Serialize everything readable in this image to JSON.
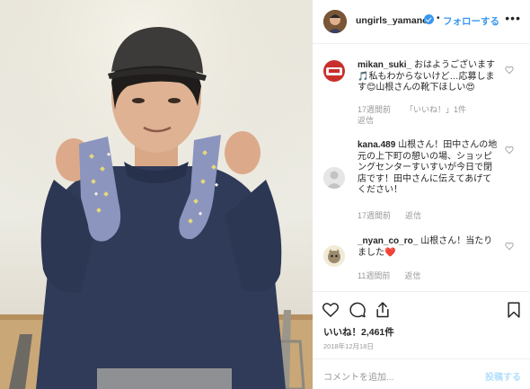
{
  "post": {
    "photo_alt": "man holding patterned socks",
    "username": "ungirls_yamane",
    "follow_label": "フォローする",
    "more_label": "•••",
    "verified": true,
    "likes_text": "いいね！2,461件",
    "date_text": "2018年12月18日",
    "add_comment_placeholder": "コメントを追加...",
    "post_button_label": "投稿する"
  },
  "comments": [
    {
      "user": "mikan_suki_",
      "text": "おはようございます🎵私もわからないけど…応募します😊山根さんの靴下ほしい😍",
      "time": "17週間前",
      "likes": "「いいね！」1件",
      "reply": "返信"
    },
    {
      "user": "kana.489",
      "text": "山根さん！田中さんの地元の上下町の憩いの場、ショッピングセンターすいすいが今日で閉店です！田中さんに伝えてあげてください！",
      "time": "17週間前",
      "reply": "返信"
    },
    {
      "user": "_nyan_co_ro_",
      "text": "山根さん！当たりました❤️",
      "time": "11週間前",
      "reply": "返信"
    }
  ],
  "colors": {
    "accent": "#3897f0",
    "muted": "#999999",
    "text": "#262626",
    "post_disabled": "#b2dffc"
  },
  "icons": [
    "heart-icon",
    "comment-icon",
    "share-icon",
    "bookmark-icon",
    "more-icon",
    "verified-badge-icon"
  ]
}
